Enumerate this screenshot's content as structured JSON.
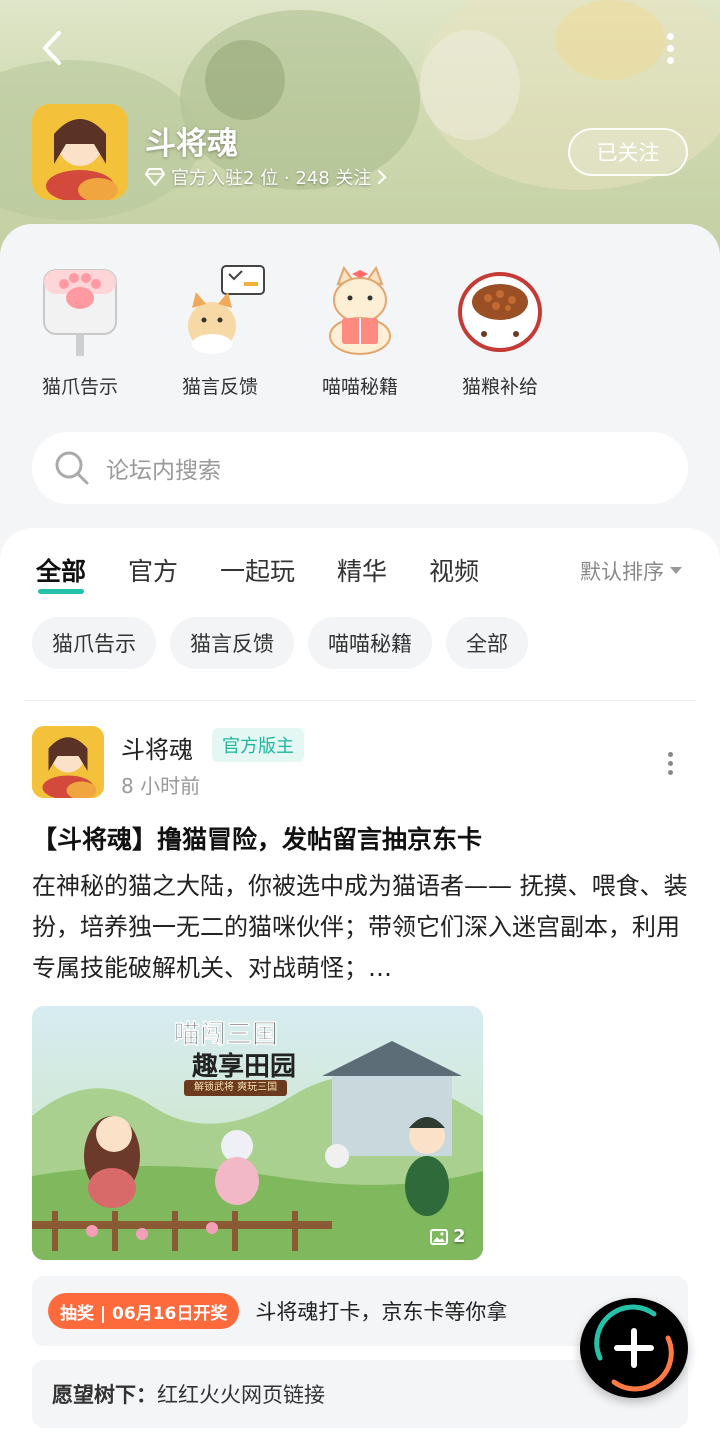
{
  "header": {
    "game_name": "斗将魂",
    "meta": "官方入驻2 位 · 248 关注",
    "follow_label": "已关注"
  },
  "shortcuts": [
    {
      "label": "猫爪告示",
      "icon": "cat-paw-sign-icon"
    },
    {
      "label": "猫言反馈",
      "icon": "cat-feedback-icon"
    },
    {
      "label": "喵喵秘籍",
      "icon": "cat-book-icon"
    },
    {
      "label": "猫粮补给",
      "icon": "cat-food-bowl-icon"
    }
  ],
  "search": {
    "placeholder": "论坛内搜索"
  },
  "tabs": [
    "全部",
    "官方",
    "一起玩",
    "精华",
    "视频"
  ],
  "sort_label": "默认排序",
  "chips": [
    "猫爪告示",
    "猫言反馈",
    "喵喵秘籍",
    "全部"
  ],
  "post": {
    "author": "斗将魂",
    "badge": "官方版主",
    "time": "8 小时前",
    "title": "【斗将魂】撸猫冒险，发帖留言抽京东卡",
    "body": "在神秘的猫之大陆，你被选中成为猫语者—— 抚摸、喂食、装扮，培养独一无二的猫咪伙伴；带领它们深入迷宫副本，利用专属技能破解机关、对战萌怪；…",
    "image_title": "喵闯三国",
    "image_subtitle": "趣享田园",
    "image_caption": "解锁武将 爽玩三国",
    "image_count": "2",
    "lottery_tag": "抽奖 | 06月16日开奖",
    "lottery_text": "斗将魂打卡，京东卡等你拿",
    "wish_key": "愿望树下：",
    "wish_value": "红红火火网页链接"
  },
  "colors": {
    "accent": "#25c2a9",
    "lottery": "#ff6a3d"
  }
}
